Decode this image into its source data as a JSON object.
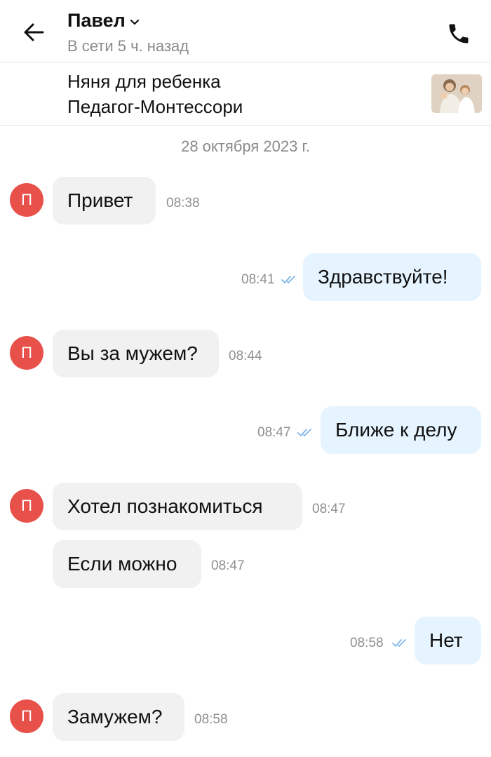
{
  "header": {
    "back_icon": "arrow-left-icon",
    "contact_name": "Павел",
    "status": "В сети 5 ч. назад",
    "call_icon": "phone-icon"
  },
  "listing": {
    "line1": "Няня для ребенка",
    "line2": "Педагог-Монтессори",
    "thumbnail": "listing-photo"
  },
  "date_separator": "28 октября 2023 г.",
  "avatar_initial": "П",
  "messages": [
    {
      "direction": "incoming",
      "text": "Привет",
      "time": "08:38"
    },
    {
      "direction": "outgoing",
      "text": "Здравствуйте!",
      "time": "08:41",
      "read": true
    },
    {
      "direction": "incoming",
      "text": "Вы за мужем?",
      "time": "08:44"
    },
    {
      "direction": "outgoing",
      "text": "Ближе к делу",
      "time": "08:47",
      "read": true
    },
    {
      "direction": "incoming",
      "text": "Хотел познакомиться",
      "time": "08:47"
    },
    {
      "direction": "incoming",
      "text": "Если можно",
      "time": "08:47"
    },
    {
      "direction": "outgoing",
      "text": "Нет",
      "time": "08:58",
      "read": true
    },
    {
      "direction": "incoming",
      "text": "Замужем?",
      "time": "08:58"
    }
  ],
  "colors": {
    "avatar": "#e8504a",
    "incoming_bubble": "#f1f1f1",
    "outgoing_bubble": "#e6f4ff",
    "read_ticks": "#7fb6e8",
    "secondary_text": "#8a8a8a"
  }
}
